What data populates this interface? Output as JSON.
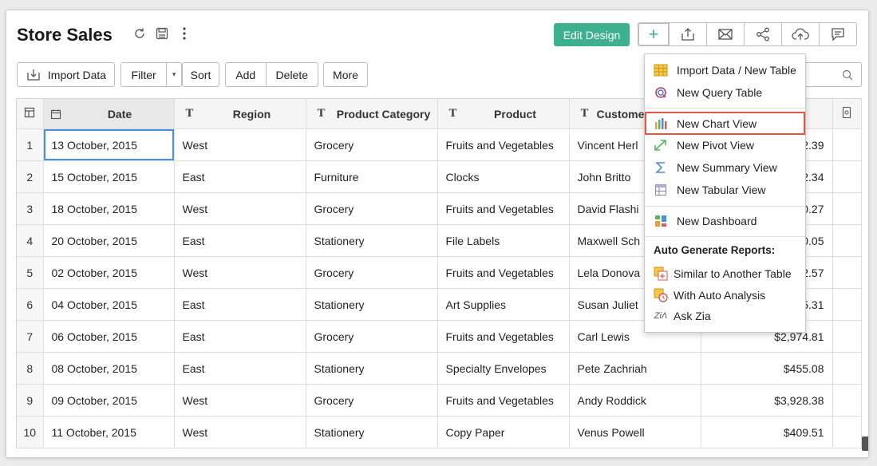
{
  "header": {
    "title": "Store Sales",
    "edit_design": "Edit Design",
    "toolbar_icons": [
      "plus-icon",
      "export-icon",
      "email-icon",
      "share-icon",
      "publish-cloud-icon",
      "comment-icon"
    ]
  },
  "toolbar": {
    "import_data": "Import Data",
    "filter": "Filter",
    "sort": "Sort",
    "add": "Add",
    "delete": "Delete",
    "more": "More"
  },
  "table": {
    "columns": [
      "Date",
      "Region",
      "Product Category",
      "Product",
      "Custome"
    ],
    "rows": [
      {
        "n": "1",
        "date": "13 October, 2015",
        "region": "West",
        "cat": "Grocery",
        "product": "Fruits and Vegetables",
        "customer": "Vincent Herl",
        "sales": "2.39"
      },
      {
        "n": "2",
        "date": "15 October, 2015",
        "region": "East",
        "cat": "Furniture",
        "product": "Clocks",
        "customer": "John Britto",
        "sales": "2.34"
      },
      {
        "n": "3",
        "date": "18 October, 2015",
        "region": "West",
        "cat": "Grocery",
        "product": "Fruits and Vegetables",
        "customer": "David Flashi",
        "sales": "0.27"
      },
      {
        "n": "4",
        "date": "20 October, 2015",
        "region": "East",
        "cat": "Stationery",
        "product": "File Labels",
        "customer": "Maxwell Sch",
        "sales": "0.05"
      },
      {
        "n": "5",
        "date": "02 October, 2015",
        "region": "West",
        "cat": "Grocery",
        "product": "Fruits and Vegetables",
        "customer": "Lela Donova",
        "sales": "2.57"
      },
      {
        "n": "6",
        "date": "04 October, 2015",
        "region": "East",
        "cat": "Stationery",
        "product": "Art Supplies",
        "customer": "Susan Juliet",
        "sales": "5.31"
      },
      {
        "n": "7",
        "date": "06 October, 2015",
        "region": "East",
        "cat": "Grocery",
        "product": "Fruits and Vegetables",
        "customer": "Carl Lewis",
        "sales": "$2,974.81"
      },
      {
        "n": "8",
        "date": "08 October, 2015",
        "region": "East",
        "cat": "Stationery",
        "product": "Specialty Envelopes",
        "customer": "Pete Zachriah",
        "sales": "$455.08"
      },
      {
        "n": "9",
        "date": "09 October, 2015",
        "region": "West",
        "cat": "Grocery",
        "product": "Fruits and Vegetables",
        "customer": "Andy Roddick",
        "sales": "$3,928.38"
      },
      {
        "n": "10",
        "date": "11 October, 2015",
        "region": "West",
        "cat": "Stationery",
        "product": "Copy Paper",
        "customer": "Venus Powell",
        "sales": "$409.51"
      }
    ]
  },
  "menu": {
    "items_top": [
      "Import Data / New Table",
      "New Query Table"
    ],
    "items_views": [
      "New Chart View",
      "New Pivot View",
      "New Summary View",
      "New Tabular View"
    ],
    "dashboard": "New Dashboard",
    "auto_header": "Auto Generate Reports:",
    "auto_items": [
      "Similar to Another Table",
      "With Auto Analysis",
      "Ask Zia"
    ]
  }
}
